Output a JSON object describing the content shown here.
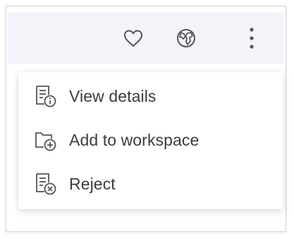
{
  "toolbar": {
    "icons": [
      "heart-icon",
      "globe-icon",
      "more-vertical-icon"
    ]
  },
  "menu": {
    "items": [
      {
        "label": "View details",
        "icon": "document-info-icon"
      },
      {
        "label": "Add to workspace",
        "icon": "folder-add-icon"
      },
      {
        "label": "Reject",
        "icon": "document-reject-icon"
      }
    ]
  },
  "colors": {
    "toolbar_background": "#f2f4fa",
    "icon_color": "#555555",
    "text_color": "#3c3c3c",
    "menu_background": "#ffffff"
  }
}
